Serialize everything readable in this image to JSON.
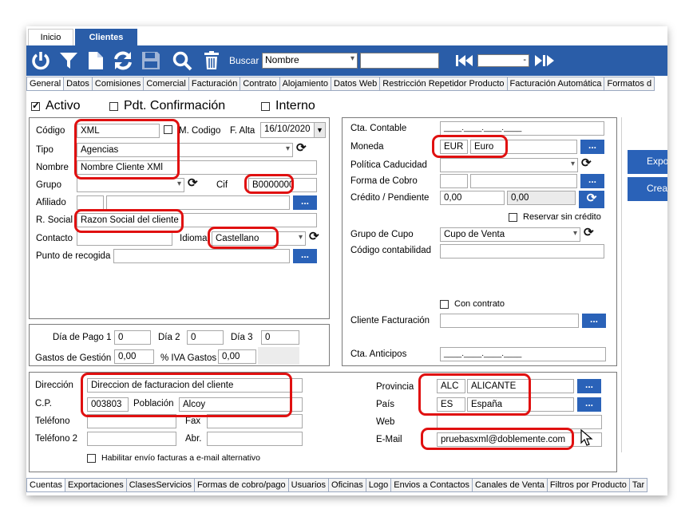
{
  "top_tabs": [
    {
      "label": "Inicio"
    },
    {
      "label": "Clientes"
    }
  ],
  "toolbar": {
    "search_label": "Buscar",
    "search_field": "Nombre",
    "search_value": "",
    "nav_value": "-",
    "icons": [
      "power-icon",
      "filter-icon",
      "new-document-icon",
      "refresh-icon",
      "save-icon",
      "search-icon",
      "delete-icon"
    ]
  },
  "section_tabs": [
    "General",
    "Datos",
    "Comisiones",
    "Comercial",
    "Facturación",
    "Contrato",
    "Alojamiento",
    "Datos Web",
    "Restricción Repetidor Producto",
    "Facturación Automática",
    "Formatos d"
  ],
  "status": {
    "activo": "Activo",
    "pdt": "Pdt. Confirmación",
    "interno": "Interno"
  },
  "left": {
    "codigo_label": "Código",
    "codigo": "XML",
    "m_codigo_label": "M. Codigo",
    "f_alta_label": "F. Alta",
    "f_alta": "16/10/2020",
    "tipo_label": "Tipo",
    "tipo": "Agencias",
    "nombre_label": "Nombre",
    "nombre": "Nombre Cliente XMl",
    "grupo_label": "Grupo",
    "grupo": "",
    "cif_label": "Cif",
    "cif": "B0000000",
    "afiliado_label": "Afiliado",
    "rsocial_label": "R. Social",
    "rsocial": "Razon Social del cliente",
    "contacto_label": "Contacto",
    "idioma_label": "Idioma",
    "idioma": "Castellano",
    "punto_label": "Punto de recogida",
    "ellipsis": "..."
  },
  "pago": {
    "dia_pago_label": "Día de Pago 1",
    "dia_pago": "0",
    "dia2_label": "Día 2",
    "dia2": "0",
    "dia3_label": "Día 3",
    "dia3": "0",
    "gastos_label": "Gastos de Gestión",
    "gastos": "0,00",
    "iva_label": "% IVA Gastos",
    "iva": "0,00"
  },
  "right": {
    "cta_contable_label": "Cta. Contable",
    "cta_contable": "____.____.____.____",
    "moneda_label": "Moneda",
    "moneda_code": "EUR",
    "moneda_name": "Euro",
    "politica_label": "Política Caducidad",
    "forma_label": "Forma de Cobro",
    "credito_label": "Crédito / Pendiente",
    "credito": "0,00",
    "pendiente": "0,00",
    "reservar_label": "Reservar sin crédito",
    "grupo_cupo_label": "Grupo de Cupo",
    "grupo_cupo": "Cupo de Venta",
    "codigo_contab_label": "Código contabilidad",
    "con_contrato_label": "Con contrato",
    "cliente_fact_label": "Cliente Facturación",
    "cta_anticipos_label": "Cta. Anticipos",
    "cta_anticipos": "____.____.____.____"
  },
  "side_buttons": [
    "Expor",
    "Crea"
  ],
  "address": {
    "direccion_label": "Dirección",
    "direccion": "Direccion de facturacion del cliente",
    "cp_label": "C.P.",
    "cp": "003803",
    "poblacion_label": "Población",
    "poblacion": "Alcoy",
    "telefono_label": "Teléfono",
    "fax_label": "Fax",
    "telefono2_label": "Teléfono 2",
    "abr_label": "Abr.",
    "provincia_label": "Provincia",
    "provincia_code": "ALC",
    "provincia": "ALICANTE",
    "pais_label": "País",
    "pais_code": "ES",
    "pais": "España",
    "web_label": "Web",
    "email_label": "E-Mail",
    "email": "pruebasxml@doblemente.com",
    "habilitar_label": "Habilitar envío facturas a e-mail alternativo"
  },
  "bottom_tabs": [
    "Cuentas",
    "Exportaciones",
    "ClasesServicios",
    "Formas de cobro/pago",
    "Usuarios",
    "Oficinas",
    "Logo",
    "Envios a Contactos",
    "Canales de Venta",
    "Filtros por Producto",
    "Tar"
  ],
  "colors": {
    "accent": "#2a5da8",
    "highlight": "#e01010"
  }
}
